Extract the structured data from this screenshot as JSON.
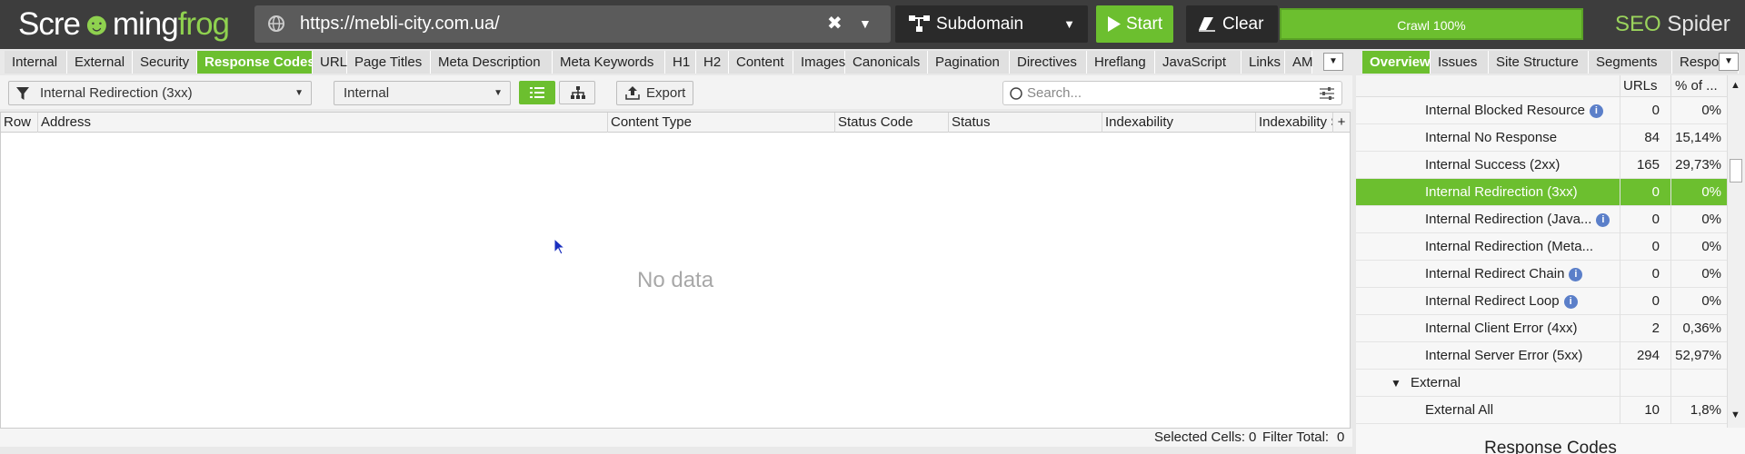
{
  "app": {
    "logo_part1": "Scre",
    "logo_part2": "ming",
    "logo_part3": "frog",
    "brand_seo": "SEO",
    "brand_spider": " Spider"
  },
  "toolbar": {
    "url": "https://mebli-city.com.ua/",
    "mode": "Subdomain",
    "start_label": "Start",
    "clear_label": "Clear",
    "progress_label": "Crawl 100%",
    "progress_value": 100
  },
  "tabs": [
    "Internal",
    "External",
    "Security",
    "Response Codes",
    "URL",
    "Page Titles",
    "Meta Description",
    "Meta Keywords",
    "H1",
    "H2",
    "Content",
    "Images",
    "Canonicals",
    "Pagination",
    "Directives",
    "Hreflang",
    "JavaScript",
    "Links",
    "AM"
  ],
  "active_tab": "Response Codes",
  "filter": {
    "type": "Internal Redirection (3xx)",
    "scope": "Internal",
    "export_label": "Export",
    "search_placeholder": "Search..."
  },
  "table": {
    "columns": [
      "Row",
      "Address",
      "Content Type",
      "Status Code",
      "Status",
      "Indexability",
      "Indexability S"
    ],
    "empty_message": "No data"
  },
  "status_bar": {
    "selected_label": "Selected Cells:",
    "selected_value": "0",
    "filter_label": "Filter Total:",
    "filter_value": "0"
  },
  "right_tabs": [
    "Overview",
    "Issues",
    "Site Structure",
    "Segments",
    "Respo"
  ],
  "right_active_tab": "Overview",
  "overview": {
    "col_urls": "URLs",
    "col_pct": "% of ...",
    "rows": [
      {
        "label": "Internal Blocked Resource",
        "urls": "0",
        "pct": "0%",
        "info": true
      },
      {
        "label": "Internal No Response",
        "urls": "84",
        "pct": "15,14%",
        "info": false
      },
      {
        "label": "Internal Success (2xx)",
        "urls": "165",
        "pct": "29,73%",
        "info": false
      },
      {
        "label": "Internal Redirection (3xx)",
        "urls": "0",
        "pct": "0%",
        "info": false,
        "selected": true
      },
      {
        "label": "Internal Redirection (Java...",
        "urls": "0",
        "pct": "0%",
        "info": true
      },
      {
        "label": "Internal Redirection (Meta...",
        "urls": "0",
        "pct": "0%",
        "info": false
      },
      {
        "label": "Internal Redirect Chain",
        "urls": "0",
        "pct": "0%",
        "info": true
      },
      {
        "label": "Internal Redirect Loop",
        "urls": "0",
        "pct": "0%",
        "info": true
      },
      {
        "label": "Internal Client Error (4xx)",
        "urls": "2",
        "pct": "0,36%",
        "info": false
      },
      {
        "label": "Internal Server Error (5xx)",
        "urls": "294",
        "pct": "52,97%",
        "info": false
      }
    ],
    "group_label": "External",
    "external_all": {
      "label": "External All",
      "urls": "10",
      "pct": "1,8%"
    }
  },
  "bottom_panel_title": "Response Codes",
  "colors": {
    "accent": "#6cbf2f",
    "topbar": "#3d3d3d"
  }
}
